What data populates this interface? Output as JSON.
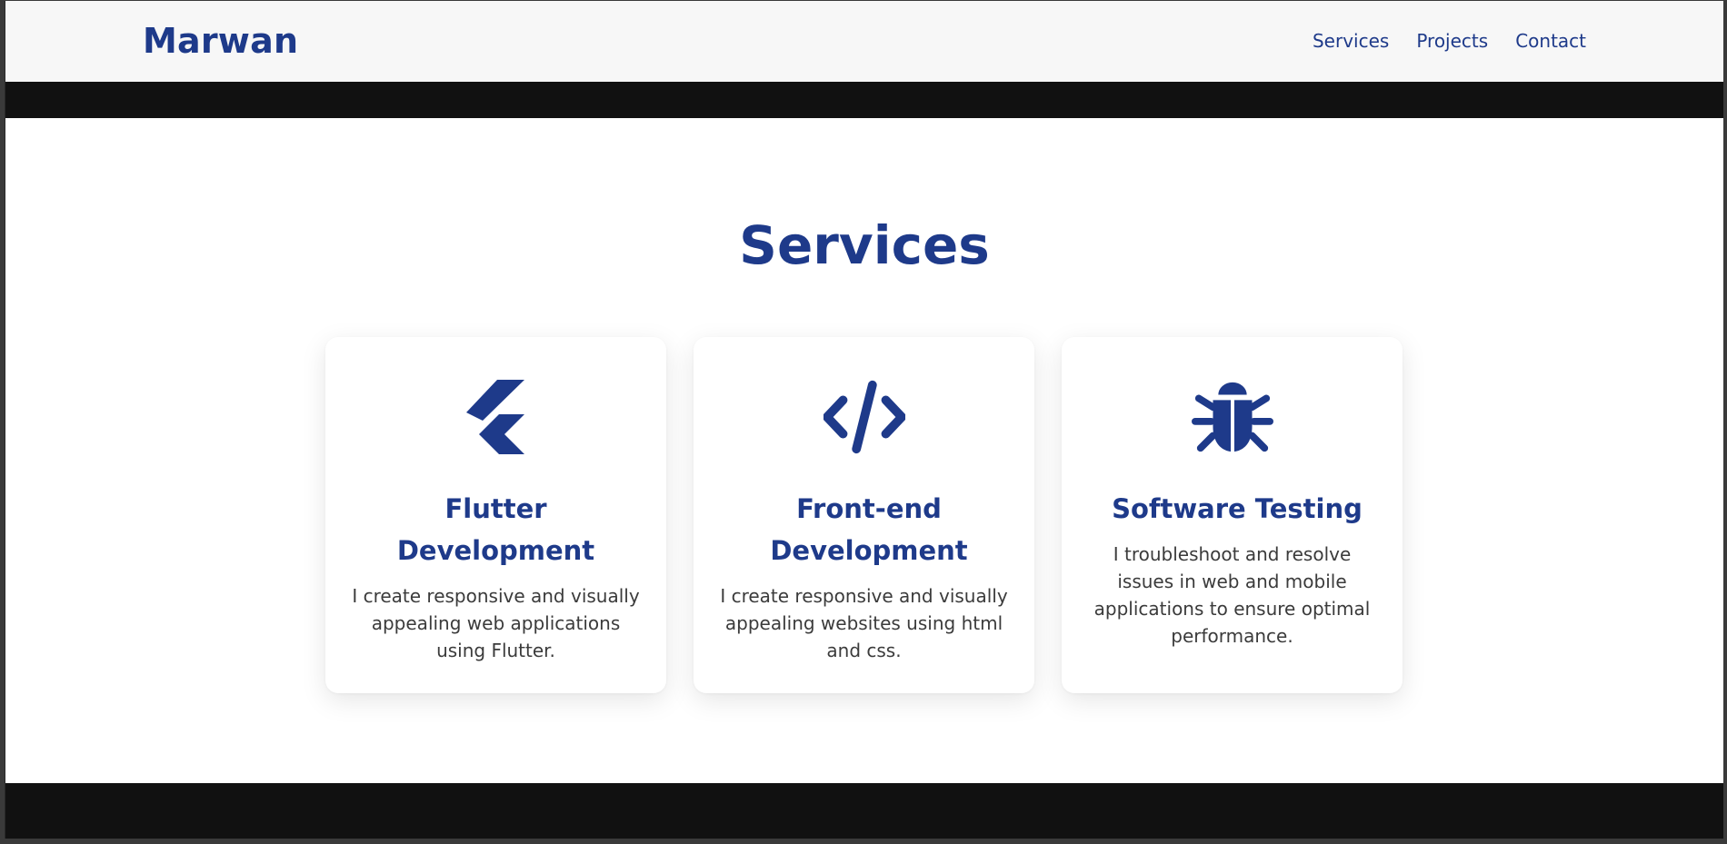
{
  "header": {
    "brand": "Marwan",
    "nav": [
      "Services",
      "Projects",
      "Contact"
    ]
  },
  "services": {
    "title": "Services",
    "cards": [
      {
        "icon": "flutter-icon",
        "title": "Flutter Development",
        "text": "I create responsive and visually appealing web applications using Flutter."
      },
      {
        "icon": "code-icon",
        "title": "Front-end Development",
        "text": "I create responsive and visually appealing websites using html and css."
      },
      {
        "icon": "bug-icon",
        "title": "Software Testing",
        "text": "I troubleshoot and resolve issues in web and mobile applications to ensure optimal performance."
      }
    ]
  },
  "colors": {
    "accent": "#1e3a8a",
    "band": "#111111",
    "header_bg": "#f7f7f7"
  }
}
